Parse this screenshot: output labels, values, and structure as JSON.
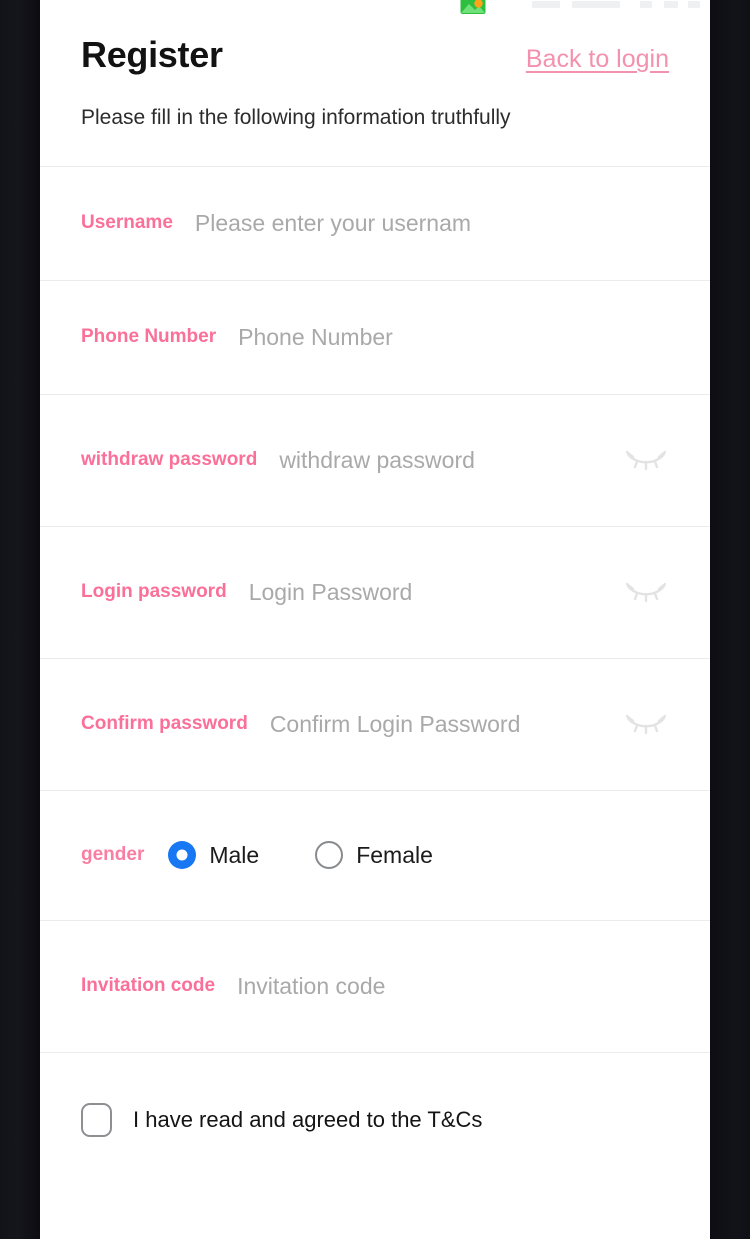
{
  "theme": {
    "accent_pink": "#fa7099",
    "link_pink": "#f491ae",
    "radio_blue": "#1877f2",
    "placeholder_gray": "#a9a9a9",
    "divider_gray": "#ececec",
    "bezel_dark": "#0e0e14"
  },
  "statusbar": {
    "icon": "gallery-image-icon"
  },
  "header": {
    "title": "Register",
    "back_link": "Back to login"
  },
  "subtitle": "Please fill in the following information truthfully",
  "fields": [
    {
      "key": "username",
      "label": "Username",
      "placeholder": "Please enter your usernam",
      "value": "",
      "has_eye": false
    },
    {
      "key": "phone",
      "label": "Phone Number",
      "placeholder": "Phone Number",
      "value": "",
      "has_eye": false
    },
    {
      "key": "withdraw_password",
      "label": "withdraw password",
      "placeholder": "withdraw password",
      "value": "",
      "has_eye": true,
      "eye_icon": "eye-closed-icon"
    },
    {
      "key": "login_password",
      "label": "Login password",
      "placeholder": "Login Password",
      "value": "",
      "has_eye": true,
      "eye_icon": "eye-closed-icon"
    },
    {
      "key": "confirm_password",
      "label": "Confirm password",
      "placeholder": "Confirm Login Password",
      "value": "",
      "has_eye": true,
      "eye_icon": "eye-closed-icon"
    }
  ],
  "gender": {
    "label": "gender",
    "selected": "Male",
    "options": [
      {
        "label": "Male",
        "selected": true
      },
      {
        "label": "Female",
        "selected": false
      }
    ]
  },
  "invitation": {
    "label": "Invitation code",
    "placeholder": "Invitation code",
    "value": ""
  },
  "terms": {
    "text": "I have read and agreed to the T&Cs",
    "checked": false
  }
}
